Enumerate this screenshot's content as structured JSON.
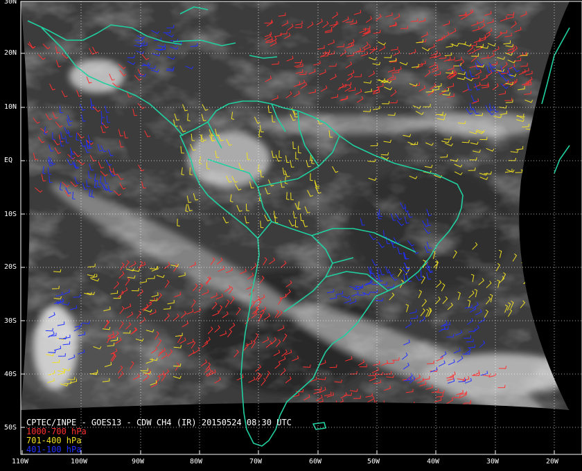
{
  "caption": {
    "title": "CPTEC/INPE - GOES13 - CDW CH4 (IR) 20150524 08:30 UTC",
    "legend": [
      {
        "label": "1000-700 hPa",
        "color": "#ff3030"
      },
      {
        "label": "701-400 hPa",
        "color": "#f0e020"
      },
      {
        "label": "401-100 hPa",
        "color": "#2030ff"
      }
    ]
  },
  "latitude_labels": [
    "30N",
    "20N",
    "10N",
    "EQ",
    "10S",
    "20S",
    "30S",
    "40S",
    "50S"
  ],
  "longitude_labels": [
    "110W",
    "100W",
    "90W",
    "80W",
    "70W",
    "60W",
    "50W",
    "40W",
    "30W",
    "20W"
  ],
  "colors": {
    "background": "#000000",
    "coastline": "#20d0a0",
    "grid": "#ffffff",
    "caption_text": "#ffffff"
  }
}
